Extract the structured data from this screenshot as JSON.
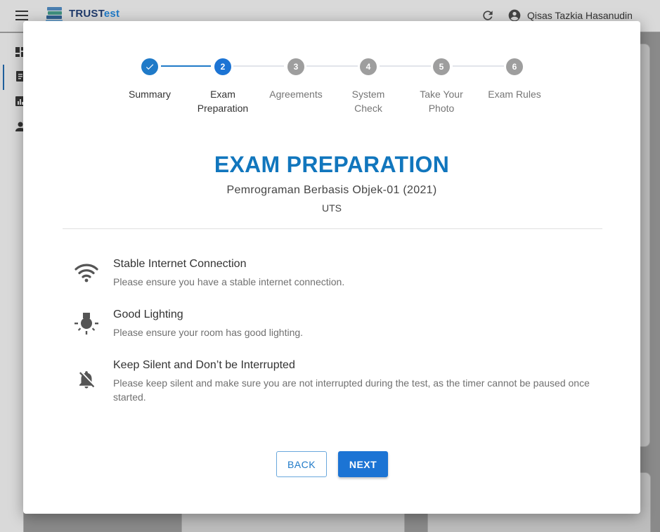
{
  "app": {
    "logo_text_a": "TRUST",
    "logo_text_b": "est",
    "user_name": "Qisas Tazkia Hasanudin"
  },
  "colors": {
    "primary": "#1c74d4",
    "title": "#1176bd",
    "step_pending": "#9e9e9e",
    "line_done": "#1f7ac8",
    "line_pending": "#e2e4ea"
  },
  "stepper": {
    "steps": [
      {
        "number": "",
        "label_line1": "Summary",
        "label_line2": "",
        "state": "done",
        "icon": "check-icon"
      },
      {
        "number": "2",
        "label_line1": "Exam",
        "label_line2": "Preparation",
        "state": "active"
      },
      {
        "number": "3",
        "label_line1": "Agreements",
        "label_line2": "",
        "state": "pending"
      },
      {
        "number": "4",
        "label_line1": "System",
        "label_line2": "Check",
        "state": "pending"
      },
      {
        "number": "5",
        "label_line1": "Take Your",
        "label_line2": "Photo",
        "state": "pending"
      },
      {
        "number": "6",
        "label_line1": "Exam Rules",
        "label_line2": "",
        "state": "pending"
      }
    ]
  },
  "header": {
    "title": "EXAM PREPARATION",
    "course": "Pemrograman Berbasis Objek-01 (2021)",
    "exam_type": "UTS"
  },
  "requirements": [
    {
      "icon": "wifi-icon",
      "title": "Stable Internet Connection",
      "description": "Please ensure you have a stable internet connection."
    },
    {
      "icon": "lightbulb-icon",
      "title": "Good Lighting",
      "description": "Please ensure your room has good lighting."
    },
    {
      "icon": "notifications-off-icon",
      "title": "Keep Silent and Don’t be Interrupted",
      "description": "Please keep silent and make sure you are not interrupted during the test, as the timer cannot be paused once started."
    }
  ],
  "actions": {
    "back_label": "BACK",
    "next_label": "NEXT"
  }
}
